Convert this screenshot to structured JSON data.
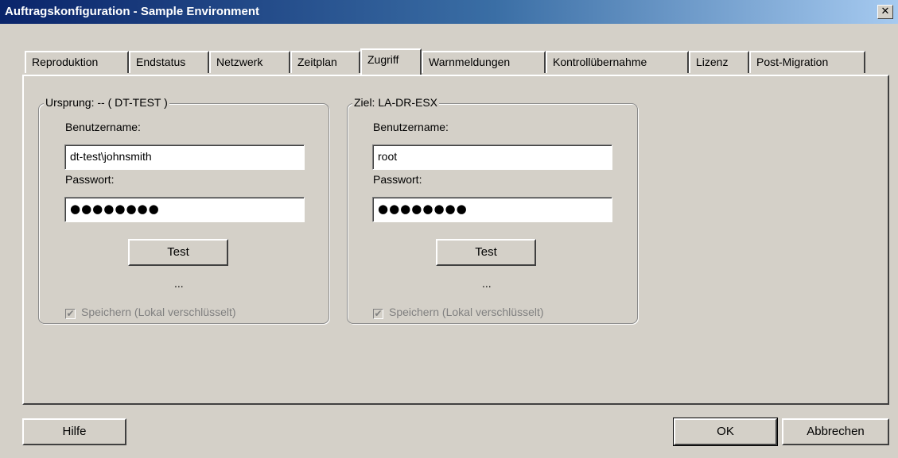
{
  "window": {
    "title": "Auftragskonfiguration - Sample Environment",
    "close_glyph": "✕"
  },
  "tabs": [
    {
      "label": "Reproduktion"
    },
    {
      "label": "Endstatus"
    },
    {
      "label": "Netzwerk"
    },
    {
      "label": "Zeitplan"
    },
    {
      "label": "Zugriff",
      "active": true
    },
    {
      "label": "Warnmeldungen"
    },
    {
      "label": "Kontrollübernahme"
    },
    {
      "label": "Lizenz"
    },
    {
      "label": "Post-Migration"
    }
  ],
  "source": {
    "title": "Ursprung: -- ( DT-TEST )",
    "username_label": "Benutzername:",
    "username_value": "dt-test\\johnsmith",
    "password_label": "Passwort:",
    "password_value": "●●●●●●●●",
    "test_label": "Test",
    "status_text": "...",
    "save_label": "Speichern (Lokal verschlüsselt)",
    "save_checked": true
  },
  "target": {
    "title": "Ziel: LA-DR-ESX",
    "username_label": "Benutzername:",
    "username_value": "root",
    "password_label": "Passwort:",
    "password_value": "●●●●●●●●",
    "test_label": "Test",
    "status_text": "...",
    "save_label": "Speichern (Lokal verschlüsselt)",
    "save_checked": true
  },
  "footer": {
    "help_label": "Hilfe",
    "ok_label": "OK",
    "cancel_label": "Abbrechen"
  },
  "colors": {
    "titlebar_start": "#0a246a",
    "titlebar_end": "#a6caf0",
    "face": "#d4d0c8"
  }
}
